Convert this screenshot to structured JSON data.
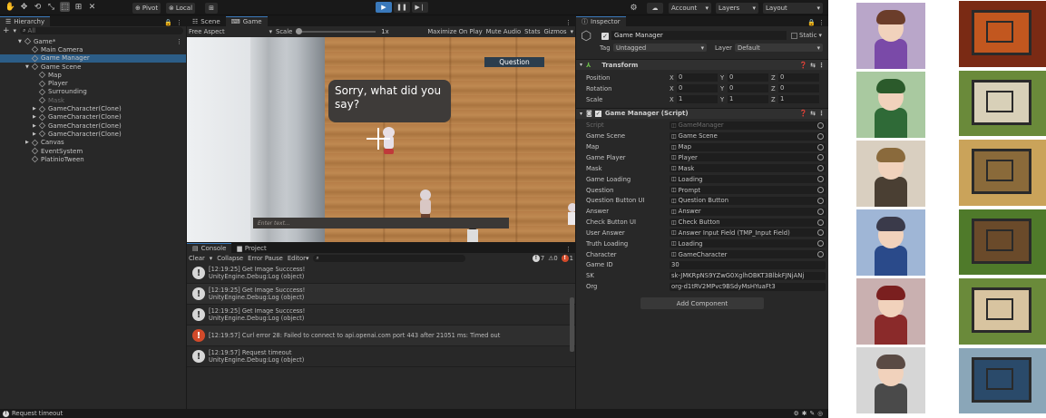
{
  "toolbar": {
    "pivot": "Pivot",
    "local": "Local",
    "account": "Account",
    "layers": "Layers",
    "layout": "Layout",
    "play_icon": "play-icon",
    "pause_icon": "pause-icon",
    "step_icon": "step-icon"
  },
  "hierarchy": {
    "tab": "Hierarchy",
    "search": "All",
    "add": "+",
    "items": [
      {
        "label": "Game*",
        "depth": 0,
        "type": "scene"
      },
      {
        "label": "Main Camera",
        "depth": 1
      },
      {
        "label": "Game Manager",
        "depth": 1,
        "selected": true
      },
      {
        "label": "Game Scene",
        "depth": 1,
        "expanded": true
      },
      {
        "label": "Map",
        "depth": 2
      },
      {
        "label": "Player",
        "depth": 2
      },
      {
        "label": "Surrounding",
        "depth": 2
      },
      {
        "label": "Mask",
        "depth": 2,
        "dim": true
      },
      {
        "label": "GameCharacter(Clone)",
        "depth": 2,
        "arrow": true
      },
      {
        "label": "GameCharacter(Clone)",
        "depth": 2,
        "arrow": true
      },
      {
        "label": "GameCharacter(Clone)",
        "depth": 2,
        "arrow": true
      },
      {
        "label": "GameCharacter(Clone)",
        "depth": 2,
        "arrow": true
      },
      {
        "label": "Canvas",
        "depth": 1,
        "arrow": true
      },
      {
        "label": "EventSystem",
        "depth": 1
      },
      {
        "label": "PlatinioTween",
        "depth": 1
      }
    ]
  },
  "game_view": {
    "tab_scene": "Scene",
    "tab_game": "Game",
    "aspect": "Free Aspect",
    "scale_label": "Scale",
    "scale_value": "1x",
    "maximize": "Maximize On Play",
    "mute": "Mute Audio",
    "stats": "Stats",
    "gizmos": "Gizmos",
    "question_button": "Question",
    "dialogue": "Sorry, what did you say?",
    "input_placeholder": "Enter text..."
  },
  "console": {
    "tab": "Console",
    "project_tab": "Project",
    "clear": "Clear",
    "collapse": "Collapse",
    "error_pause": "Error Pause",
    "editor": "Editor",
    "count_info": "7",
    "count_warn": "0",
    "count_err": "1",
    "entries": [
      {
        "line1": "[12:19:25] Get Image Succcess!",
        "line2": "UnityEngine.Debug:Log (object)",
        "type": "info"
      },
      {
        "line1": "[12:19:25] Get Image Succcess!",
        "line2": "UnityEngine.Debug:Log (object)",
        "type": "info"
      },
      {
        "line1": "[12:19:25] Get Image Succcess!",
        "line2": "UnityEngine.Debug:Log (object)",
        "type": "info"
      },
      {
        "line1": "[12:19:57] Curl error 28: Failed to connect to api.openai.com port 443 after 21051 ms: Timed out",
        "line2": "",
        "type": "error"
      },
      {
        "line1": "[12:19:57] Request timeout",
        "line2": "UnityEngine.Debug:Log (object)",
        "type": "info"
      }
    ]
  },
  "inspector": {
    "tab": "Inspector",
    "name": "Game Manager",
    "static": "Static",
    "tag_label": "Tag",
    "tag": "Untagged",
    "layer_label": "Layer",
    "layer": "Default",
    "transform": {
      "title": "Transform",
      "rows": [
        {
          "label": "Position",
          "x": "0",
          "y": "0",
          "z": "0"
        },
        {
          "label": "Rotation",
          "x": "0",
          "y": "0",
          "z": "0"
        },
        {
          "label": "Scale",
          "x": "1",
          "y": "1",
          "z": "1"
        }
      ]
    },
    "script_title": "Game Manager (Script)",
    "fields": [
      {
        "label": "Script",
        "value": "GameManager",
        "dim": true
      },
      {
        "label": "Game Scene",
        "value": "Game Scene"
      },
      {
        "label": "Map",
        "value": "Map"
      },
      {
        "label": "Game Player",
        "value": "Player"
      },
      {
        "label": "Mask",
        "value": "Mask"
      },
      {
        "label": "Game Loading",
        "value": "Loading"
      },
      {
        "label": "Question",
        "value": "Prompt"
      },
      {
        "label": "Question Button UI",
        "value": "Question Button"
      },
      {
        "label": "Answer",
        "value": "Answer"
      },
      {
        "label": "Check Button UI",
        "value": "Check Button"
      },
      {
        "label": "User Answer",
        "value": "Answer Input Field (TMP_Input Field)"
      },
      {
        "label": "Truth Loading",
        "value": "Loading"
      },
      {
        "label": "Character",
        "value": "GameCharacter"
      },
      {
        "label": "Game ID",
        "value": "30",
        "plain": true
      },
      {
        "label": "SK",
        "value": "sk-JMKRpNS9YZwG0XglhOBKT3BlbkFJNjANj",
        "plain": true
      },
      {
        "label": "Org",
        "value": "org-d1tRV2MPvc9BSdyMsHYuaFt3",
        "plain": true
      }
    ],
    "add_component": "Add Component"
  },
  "status": {
    "message": "Request timeout"
  },
  "colors": {
    "accent": "#3a79bb",
    "selection": "#2c5d87",
    "error": "#d24a2a",
    "question_bg": "#2b3d4d"
  }
}
